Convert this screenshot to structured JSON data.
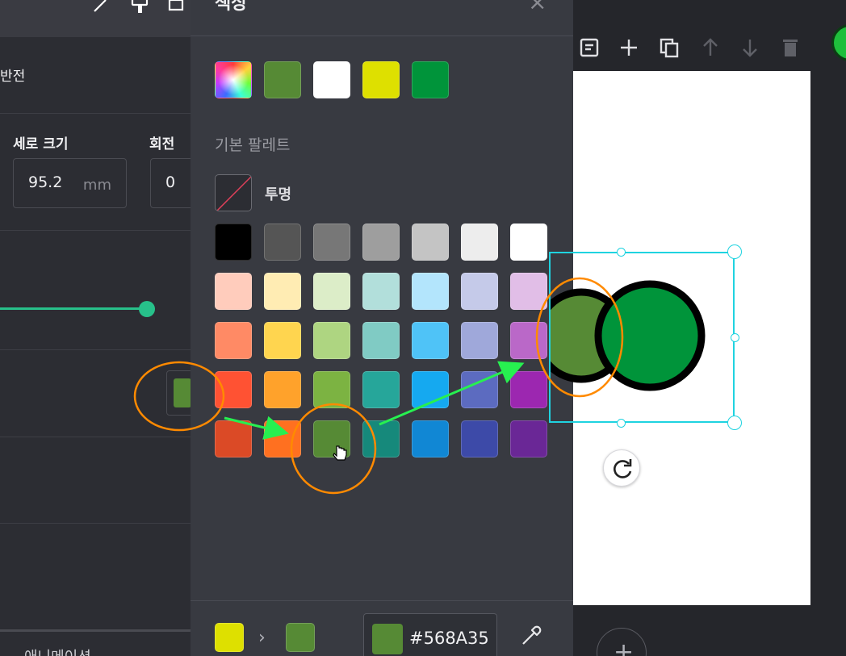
{
  "left_panel": {
    "flip_label": "반전",
    "height_label": "세로 크기",
    "rotate_label": "회전",
    "height_value": "95.2",
    "height_unit": "mm",
    "rotate_value": "0",
    "bottom_tab_label": "애니메이션",
    "slider_value_pct": 100
  },
  "color_panel": {
    "title": "색상",
    "close_glyph": "×",
    "recent_colors": [
      "#568A35",
      "#FFFFFF",
      "#DEE000",
      "#00943A"
    ],
    "palette_label": "기본 팔레트",
    "transparent_label": "투명",
    "palette": [
      [
        "#000000",
        "#555555",
        "#777777",
        "#9E9E9E",
        "#C4C4C4",
        "#EDEDED",
        "#FFFFFF"
      ],
      [
        "#FFCCBC",
        "#FFECB3",
        "#DCEDC8",
        "#B2DFDB",
        "#B3E5FC",
        "#C5CAE9",
        "#E1BEE7"
      ],
      [
        "#FF8A65",
        "#FFD54F",
        "#AED581",
        "#80CBC4",
        "#4FC3F7",
        "#9FA8DA",
        "#BA68C8"
      ],
      [
        "#FF5233",
        "#FFA22B",
        "#7CB342",
        "#26A69A",
        "#15A9F0",
        "#5C6BC0",
        "#9C27B0"
      ],
      [
        "#DB4A26",
        "#FF7020",
        "#568A35",
        "#16897B",
        "#1187D4",
        "#3D4AA8",
        "#6A2796"
      ]
    ],
    "footer": {
      "from_color": "#DEE000",
      "arrow_glyph": "›",
      "to_color": "#568A35",
      "hex_value": "#568A35"
    }
  },
  "canvas": {
    "add_page_glyph": "+",
    "circle_left_fill": "#568A35",
    "circle_right_fill": "#00943A"
  },
  "annotations": {
    "ellipse_color": "#FF8A00",
    "arrow_color": "#27F050"
  }
}
